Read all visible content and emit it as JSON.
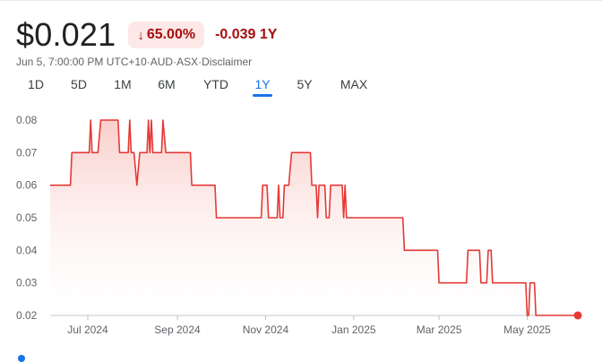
{
  "header": {
    "price": "$0.021",
    "change_pct": "65.00%",
    "change_abs": "-0.039 1Y",
    "direction_icon": "arrow-down-icon"
  },
  "meta": {
    "timestamp": "Jun 5, 7:00:00 PM UTC+10",
    "currency": "AUD",
    "exchange": "ASX",
    "disclaimer": "Disclaimer",
    "separator": " · "
  },
  "tabs": [
    {
      "label": "1D",
      "active": false
    },
    {
      "label": "5D",
      "active": false
    },
    {
      "label": "1M",
      "active": false
    },
    {
      "label": "6M",
      "active": false
    },
    {
      "label": "YTD",
      "active": false
    },
    {
      "label": "1Y",
      "active": true
    },
    {
      "label": "5Y",
      "active": false
    },
    {
      "label": "MAX",
      "active": false
    }
  ],
  "colors": {
    "line": "#e53935",
    "fill_top": "#f8c9c5",
    "accent": "#1a73e8",
    "negative": "#a50e0e"
  },
  "chart_data": {
    "type": "area",
    "step": true,
    "grid": false,
    "baseline": 0.02,
    "ylim": [
      0.02,
      0.08
    ],
    "y_ticks": [
      "0.08",
      "0.07",
      "0.06",
      "0.05",
      "0.04",
      "0.03",
      "0.02"
    ],
    "x_ticks": [
      {
        "label": "Jul 2024",
        "date": "2024-07-01"
      },
      {
        "label": "Sep 2024",
        "date": "2024-09-01"
      },
      {
        "label": "Nov 2024",
        "date": "2024-11-01"
      },
      {
        "label": "Jan 2025",
        "date": "2025-01-01"
      },
      {
        "label": "Mar 2025",
        "date": "2025-03-01"
      },
      {
        "label": "May 2025",
        "date": "2025-05-01"
      }
    ],
    "series": [
      {
        "points": [
          [
            "2024-06-05",
            0.06
          ],
          [
            "2024-06-19",
            0.06
          ],
          [
            "2024-06-20",
            0.07
          ],
          [
            "2024-07-02",
            0.07
          ],
          [
            "2024-07-03",
            0.08
          ],
          [
            "2024-07-04",
            0.07
          ],
          [
            "2024-07-08",
            0.07
          ],
          [
            "2024-07-10",
            0.08
          ],
          [
            "2024-07-22",
            0.08
          ],
          [
            "2024-07-23",
            0.07
          ],
          [
            "2024-07-29",
            0.07
          ],
          [
            "2024-07-30",
            0.08
          ],
          [
            "2024-07-31",
            0.07
          ],
          [
            "2024-08-02",
            0.07
          ],
          [
            "2024-08-04",
            0.06
          ],
          [
            "2024-08-06",
            0.07
          ],
          [
            "2024-08-11",
            0.07
          ],
          [
            "2024-08-12",
            0.08
          ],
          [
            "2024-08-13",
            0.07
          ],
          [
            "2024-08-14",
            0.08
          ],
          [
            "2024-08-15",
            0.07
          ],
          [
            "2024-08-21",
            0.07
          ],
          [
            "2024-08-22",
            0.08
          ],
          [
            "2024-08-24",
            0.07
          ],
          [
            "2024-09-10",
            0.07
          ],
          [
            "2024-09-11",
            0.06
          ],
          [
            "2024-09-27",
            0.06
          ],
          [
            "2024-09-28",
            0.05
          ],
          [
            "2024-10-29",
            0.05
          ],
          [
            "2024-10-30",
            0.06
          ],
          [
            "2024-11-02",
            0.06
          ],
          [
            "2024-11-03",
            0.05
          ],
          [
            "2024-11-09",
            0.05
          ],
          [
            "2024-11-10",
            0.06
          ],
          [
            "2024-11-11",
            0.05
          ],
          [
            "2024-11-13",
            0.05
          ],
          [
            "2024-11-14",
            0.06
          ],
          [
            "2024-11-17",
            0.06
          ],
          [
            "2024-11-19",
            0.07
          ],
          [
            "2024-12-02",
            0.07
          ],
          [
            "2024-12-03",
            0.06
          ],
          [
            "2024-12-06",
            0.06
          ],
          [
            "2024-12-07",
            0.05
          ],
          [
            "2024-12-08",
            0.06
          ],
          [
            "2024-12-12",
            0.06
          ],
          [
            "2024-12-13",
            0.05
          ],
          [
            "2024-12-15",
            0.05
          ],
          [
            "2024-12-16",
            0.06
          ],
          [
            "2024-12-24",
            0.06
          ],
          [
            "2024-12-25",
            0.05
          ],
          [
            "2024-12-26",
            0.06
          ],
          [
            "2024-12-27",
            0.05
          ],
          [
            "2025-02-04",
            0.05
          ],
          [
            "2025-02-05",
            0.04
          ],
          [
            "2025-02-28",
            0.04
          ],
          [
            "2025-03-01",
            0.03
          ],
          [
            "2025-03-20",
            0.03
          ],
          [
            "2025-03-21",
            0.04
          ],
          [
            "2025-03-29",
            0.04
          ],
          [
            "2025-03-30",
            0.03
          ],
          [
            "2025-04-03",
            0.03
          ],
          [
            "2025-04-04",
            0.04
          ],
          [
            "2025-04-06",
            0.04
          ],
          [
            "2025-04-07",
            0.03
          ],
          [
            "2025-04-30",
            0.03
          ],
          [
            "2025-05-01",
            0.02
          ],
          [
            "2025-05-02",
            0.02
          ],
          [
            "2025-05-03",
            0.03
          ],
          [
            "2025-05-06",
            0.03
          ],
          [
            "2025-05-07",
            0.02
          ],
          [
            "2025-06-05",
            0.02
          ]
        ]
      }
    ],
    "end_marker": true
  }
}
